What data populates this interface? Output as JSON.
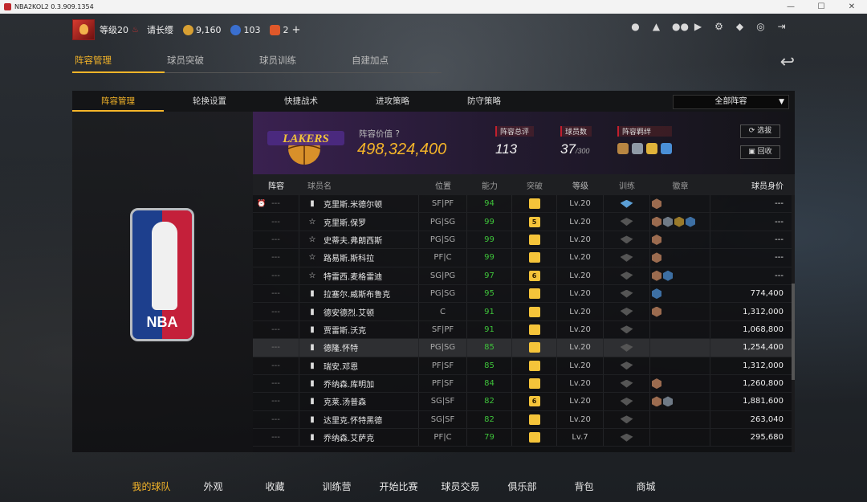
{
  "window": {
    "title": "NBA2KOL2 0.3.909.1354"
  },
  "topbar": {
    "level": "等级20",
    "greeting": "请长缨",
    "coins": "9,160",
    "points": "103",
    "tickets": "2",
    "plus": "+"
  },
  "main_tabs": [
    "阵容管理",
    "球员突破",
    "球员训练",
    "自建加点"
  ],
  "sub_tabs": [
    "阵容管理",
    "轮换设置",
    "快捷战术",
    "进攻策略",
    "防守策略"
  ],
  "lineup_filter": "全部阵容",
  "summary": {
    "value_label": "阵容价值",
    "value": "498,324,400",
    "total_rating_label": "阵容总评",
    "total_rating": "113",
    "player_count_label": "球员数",
    "player_count": "37",
    "player_cap": "/300",
    "bond_label": "阵容羁绊",
    "select_btn": "选拔",
    "recycle_btn": "回收"
  },
  "table": {
    "headers": [
      "阵容",
      "球员名",
      "位置",
      "能力",
      "突破",
      "等级",
      "训练",
      "徽章",
      "球员身价"
    ],
    "rows": [
      {
        "lineup": "---",
        "name": "克里斯.米德尔顿",
        "pos": "SF|PF",
        "ovr": "94",
        "brk": "",
        "lvl": "Lv.20",
        "val": "---"
      },
      {
        "lineup": "---",
        "name": "克里斯.保罗",
        "pos": "PG|SG",
        "ovr": "99",
        "brk": "5",
        "lvl": "Lv.20",
        "val": "---"
      },
      {
        "lineup": "---",
        "name": "史蒂夫.弗朗西斯",
        "pos": "PG|SG",
        "ovr": "99",
        "brk": "",
        "lvl": "Lv.20",
        "val": "---"
      },
      {
        "lineup": "---",
        "name": "路易斯.斯科拉",
        "pos": "PF|C",
        "ovr": "99",
        "brk": "",
        "lvl": "Lv.20",
        "val": "---"
      },
      {
        "lineup": "---",
        "name": "特雷西.麦格雷迪",
        "pos": "SG|PG",
        "ovr": "97",
        "brk": "6",
        "lvl": "Lv.20",
        "val": "---"
      },
      {
        "lineup": "---",
        "name": "拉塞尔.威斯布鲁克",
        "pos": "PG|SG",
        "ovr": "95",
        "brk": "",
        "lvl": "Lv.20",
        "val": "774,400"
      },
      {
        "lineup": "---",
        "name": "德安德烈.艾顿",
        "pos": "C",
        "ovr": "91",
        "brk": "",
        "lvl": "Lv.20",
        "val": "1,312,000"
      },
      {
        "lineup": "---",
        "name": "贾雷斯.沃克",
        "pos": "SF|PF",
        "ovr": "91",
        "brk": "",
        "lvl": "Lv.20",
        "val": "1,068,800"
      },
      {
        "lineup": "---",
        "name": "德隆.怀特",
        "pos": "PG|SG",
        "ovr": "85",
        "brk": "",
        "lvl": "Lv.20",
        "val": "1,254,400"
      },
      {
        "lineup": "---",
        "name": "瑞安.邓恩",
        "pos": "PF|SF",
        "ovr": "85",
        "brk": "",
        "lvl": "Lv.20",
        "val": "1,312,000"
      },
      {
        "lineup": "---",
        "name": "乔纳森.库明加",
        "pos": "PF|SF",
        "ovr": "84",
        "brk": "",
        "lvl": "Lv.20",
        "val": "1,260,800"
      },
      {
        "lineup": "---",
        "name": "克莱.汤普森",
        "pos": "SG|SF",
        "ovr": "82",
        "brk": "6",
        "lvl": "Lv.20",
        "val": "1,881,600"
      },
      {
        "lineup": "---",
        "name": "达里克.怀特黑德",
        "pos": "SG|SF",
        "ovr": "82",
        "brk": "",
        "lvl": "Lv.20",
        "val": "263,040"
      },
      {
        "lineup": "---",
        "name": "乔纳森.艾萨克",
        "pos": "PF|C",
        "ovr": "79",
        "brk": "",
        "lvl": "Lv.7",
        "val": "295,680"
      }
    ]
  },
  "bottom_nav": [
    "我的球队",
    "外观",
    "收藏",
    "训练营",
    "开始比赛",
    "球员交易",
    "俱乐部",
    "背包",
    "商城"
  ],
  "colors": {
    "accent": "#f5b529",
    "rating": "#3ec23a",
    "panel": "#0f1012"
  }
}
